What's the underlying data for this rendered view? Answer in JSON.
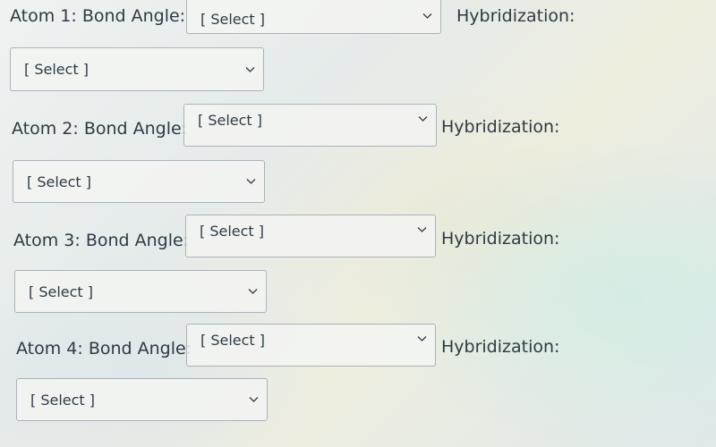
{
  "atoms": [
    {
      "label": "Atom 1:  Bond Angle:",
      "bond_angle_value": "[ Select ]",
      "hybridization_label": "Hybridization:",
      "hybridization_value": "[ Select ]"
    },
    {
      "label": "Atom 2: Bond Angle:",
      "bond_angle_value": "[ Select ]",
      "hybridization_label": "Hybridization:",
      "hybridization_value": "[ Select ]"
    },
    {
      "label": "Atom 3: Bond Angle:",
      "bond_angle_value": "[ Select ]",
      "hybridization_label": "Hybridization:",
      "hybridization_value": "[ Select ]"
    },
    {
      "label": "Atom 4: Bond Angle:",
      "bond_angle_value": "[ Select ]",
      "hybridization_label": "Hybridization:",
      "hybridization_value": "[ Select ]"
    }
  ],
  "icons": {
    "dropdown": "chevron-down-icon"
  }
}
